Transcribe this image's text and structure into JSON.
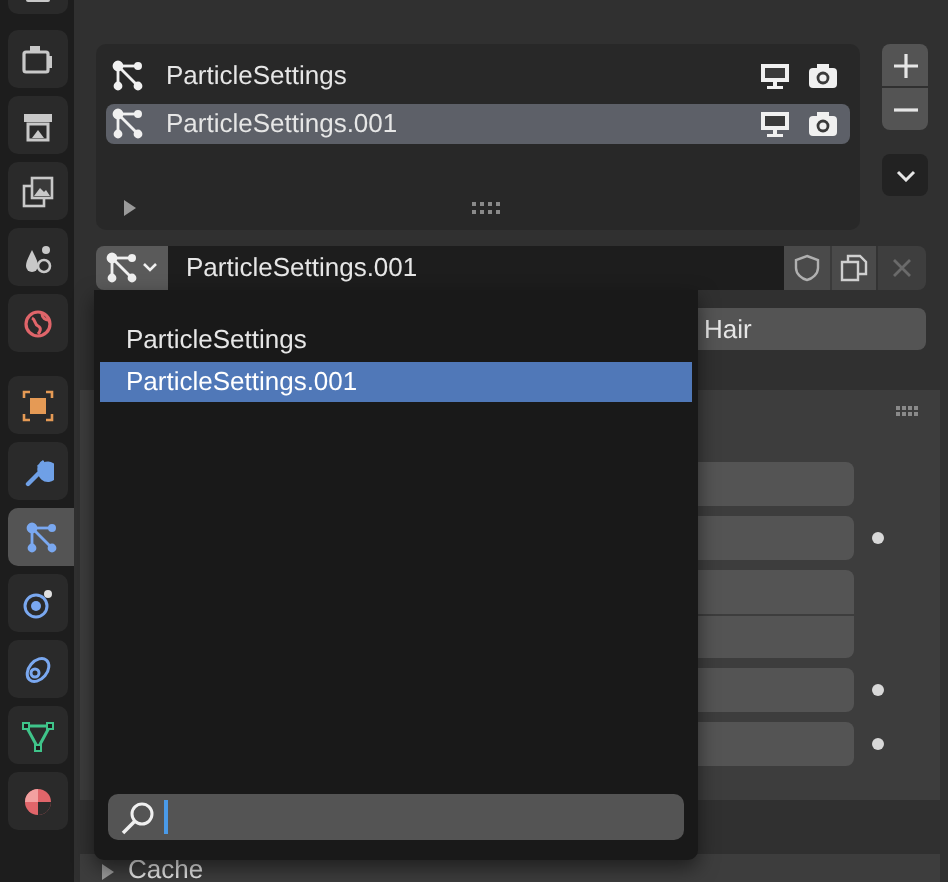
{
  "sidebar": {
    "tabs": [
      {
        "selected": false
      },
      {
        "selected": false
      },
      {
        "selected": false
      },
      {
        "selected": false
      },
      {
        "selected": false
      },
      {
        "selected": false
      },
      {
        "selected": false
      },
      {
        "selected": false
      },
      {
        "selected": true
      },
      {
        "selected": false
      },
      {
        "selected": false
      },
      {
        "selected": false
      },
      {
        "selected": false
      }
    ]
  },
  "particle_systems": [
    {
      "name": "ParticleSettings",
      "selected": false
    },
    {
      "name": "ParticleSettings.001",
      "selected": true
    }
  ],
  "datablock": {
    "name": "ParticleSettings.001"
  },
  "type_toggle": {
    "label": "Hair"
  },
  "emission": {
    "groups": [
      [
        {
          "animatable": false
        }
      ],
      [
        {
          "animatable": true
        }
      ],
      [
        {
          "animatable": false
        },
        {
          "animatable": false
        }
      ],
      [
        {
          "animatable": true
        }
      ],
      [
        {
          "animatable": true
        }
      ]
    ]
  },
  "cache": {
    "title": "Cache"
  },
  "dropdown": {
    "items": [
      {
        "label": "ParticleSettings",
        "selected": false
      },
      {
        "label": "ParticleSettings.001",
        "selected": true
      }
    ]
  }
}
